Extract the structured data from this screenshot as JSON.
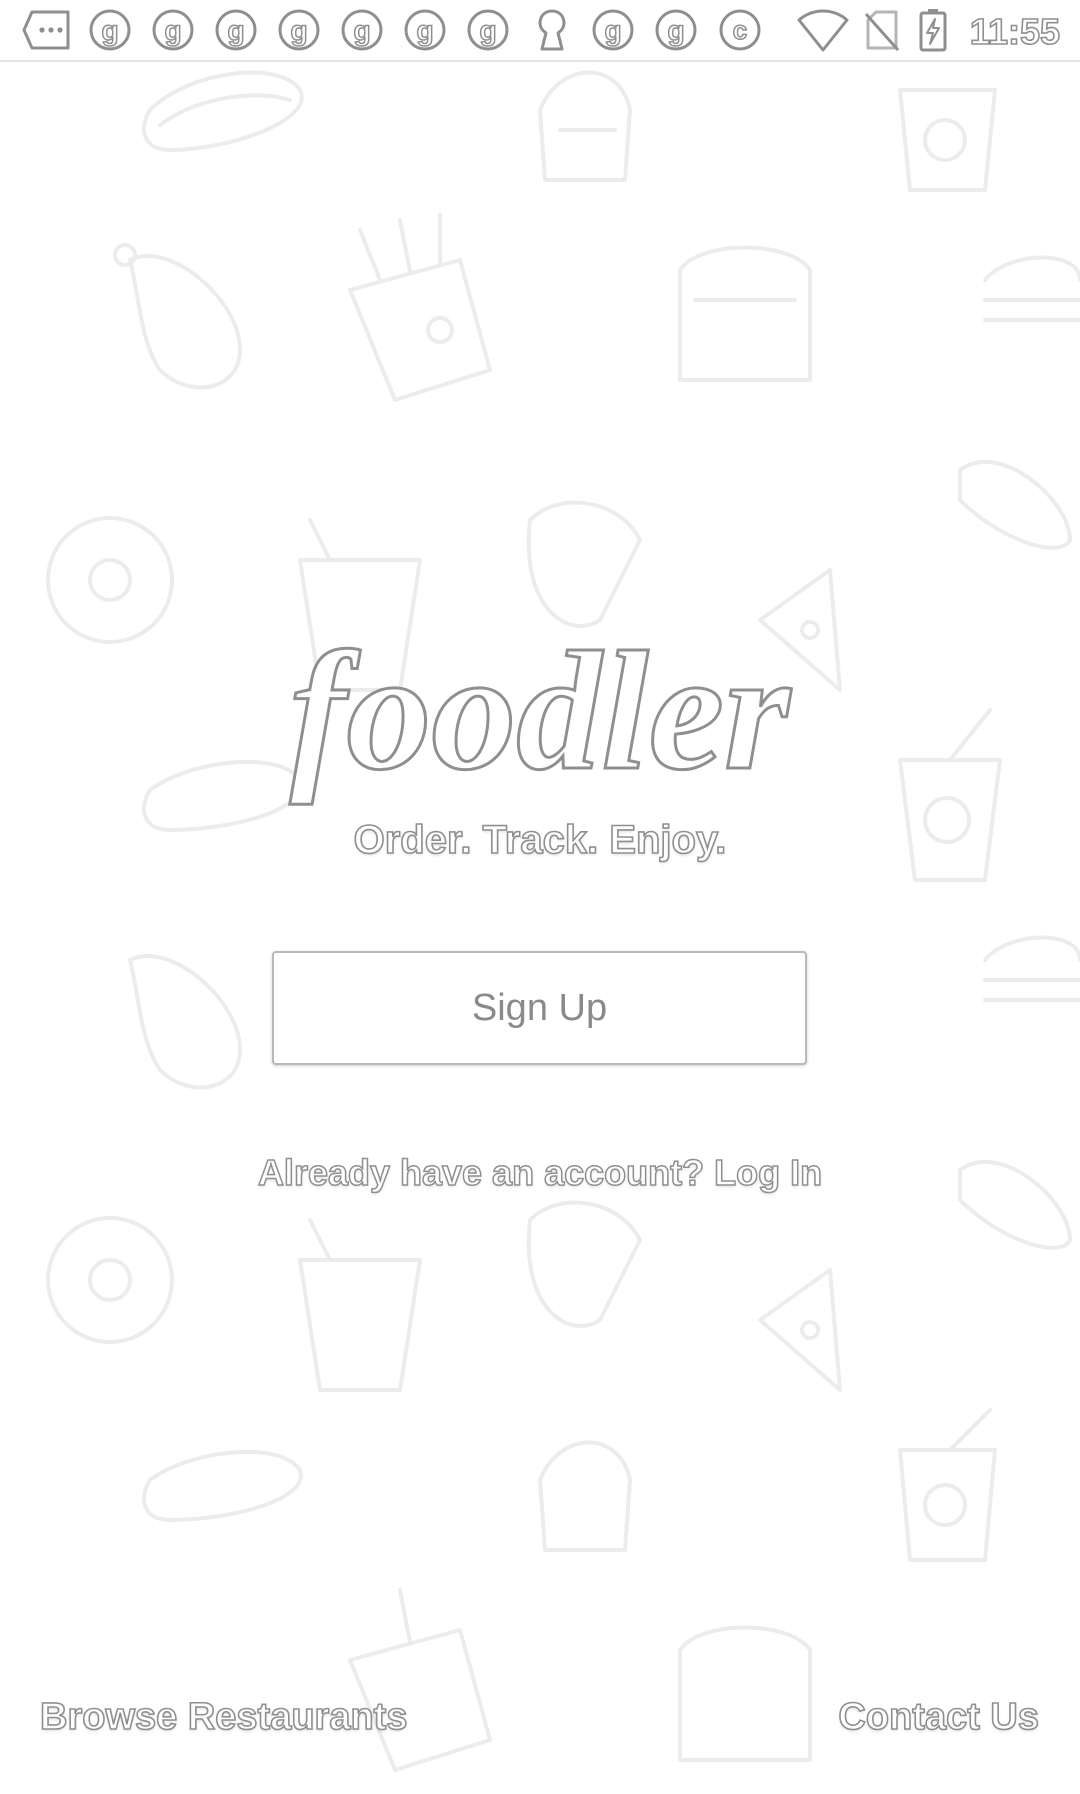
{
  "status_bar": {
    "time": "11:55",
    "icons": [
      "more-icon",
      "notification-g-icon",
      "notification-g-icon",
      "notification-g-icon",
      "notification-g-icon",
      "notification-g-icon",
      "notification-g-icon",
      "notification-g-icon",
      "keyhole-icon",
      "notification-g-icon",
      "notification-g-icon",
      "copyright-icon",
      "wifi-icon",
      "no-sim-icon",
      "battery-charging-icon"
    ]
  },
  "app": {
    "logo_text": "foodler",
    "tagline": "Order. Track. Enjoy."
  },
  "actions": {
    "signup_label": "Sign Up",
    "login_prompt": "Already have an account? Log In"
  },
  "footer": {
    "browse_label": "Browse Restaurants",
    "contact_label": "Contact Us"
  },
  "colors": {
    "outline": "#8f8f8f",
    "background": "#ffffff",
    "pattern": "#ececec"
  }
}
